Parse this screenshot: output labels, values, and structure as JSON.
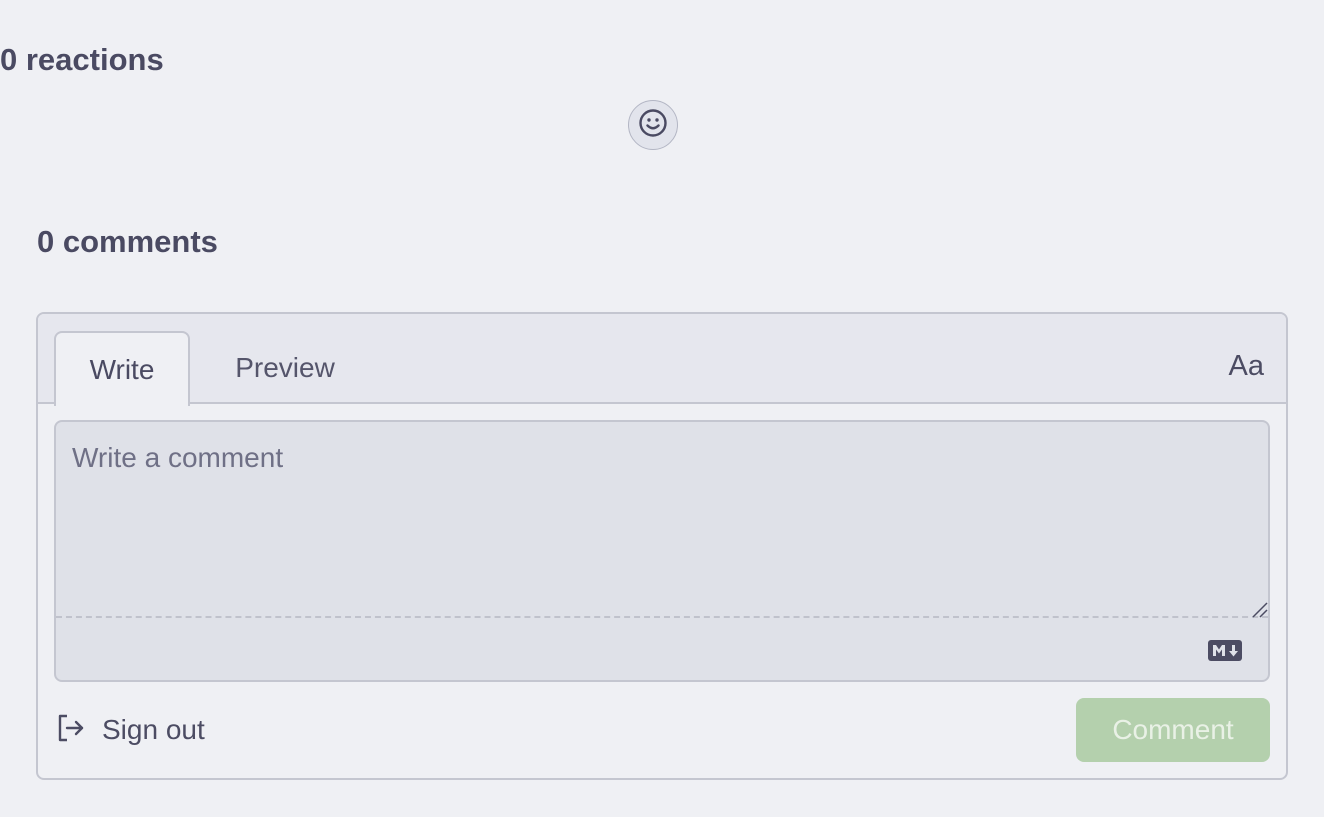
{
  "reactions": {
    "title": "0 reactions",
    "add_reaction_icon": "smiley-face-icon"
  },
  "comments": {
    "title": "0 comments"
  },
  "editor": {
    "tabs": [
      {
        "label": "Write",
        "active": true
      },
      {
        "label": "Preview",
        "active": false
      }
    ],
    "font_toggle_label": "Aa",
    "placeholder": "Write a comment",
    "markdown_icon": "markdown-icon"
  },
  "footer": {
    "sign_out_label": "Sign out",
    "sign_out_icon": "sign-out-icon",
    "submit_label": "Comment"
  },
  "colors": {
    "background": "#eff0f4",
    "text": "#4a4a62",
    "submit_disabled": "#b4d0ad"
  }
}
